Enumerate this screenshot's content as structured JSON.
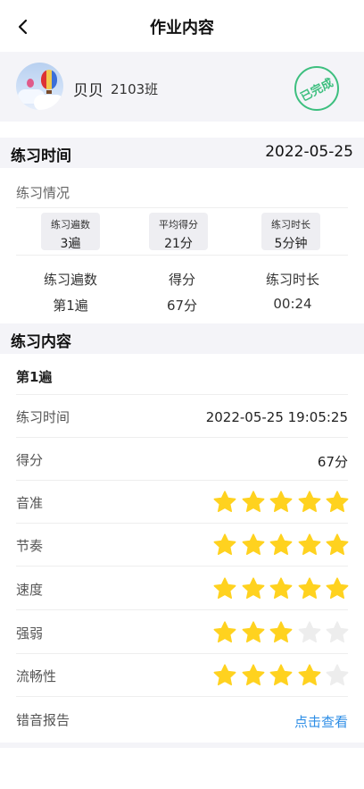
{
  "header": {
    "title": "作业内容"
  },
  "profile": {
    "name": "贝贝",
    "class_name": "2103班",
    "status_stamp": "已完成"
  },
  "practice_time": {
    "label": "练习时间",
    "date": "2022-05-25"
  },
  "summary": {
    "title": "练习情况",
    "chips": [
      {
        "label": "练习遍数",
        "value": "3遍"
      },
      {
        "label": "平均得分",
        "value": "21分"
      },
      {
        "label": "练习时长",
        "value": "5分钟"
      }
    ],
    "columns": [
      {
        "header": "练习遍数",
        "value": "第1遍"
      },
      {
        "header": "得分",
        "value": "67分"
      },
      {
        "header": "练习时长",
        "value": "00:24"
      }
    ]
  },
  "content": {
    "title": "练习内容",
    "pass_label": "第1遍",
    "time_label": "练习时间",
    "time_value": "2022-05-25 19:05:25",
    "score_label": "得分",
    "score_value": "67分",
    "ratings": [
      {
        "label": "音准",
        "stars": 5
      },
      {
        "label": "节奏",
        "stars": 5
      },
      {
        "label": "速度",
        "stars": 5
      },
      {
        "label": "强弱",
        "stars": 3
      },
      {
        "label": "流畅性",
        "stars": 4
      }
    ],
    "max_stars": 5,
    "report_label": "错音报告",
    "report_link": "点击查看"
  },
  "colors": {
    "star_filled": "#FFD21F",
    "star_empty": "#EDEDED",
    "stamp_green": "#3DBF7F",
    "link_blue": "#2E8EE6",
    "section_bg": "#F4F4F8"
  }
}
